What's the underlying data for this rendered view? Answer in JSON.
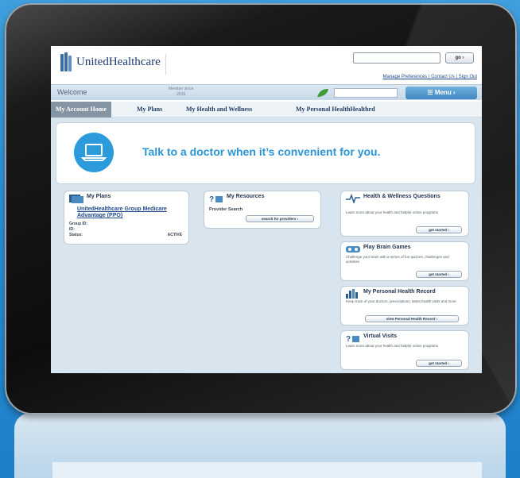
{
  "header": {
    "logo_text": "UnitedHealthcare",
    "go_label": "go ›",
    "util_links": "Manage Preferences | Contact Us | Sign Out"
  },
  "welcome_bar": {
    "welcome": "Welcome",
    "member_since_label": "Member since",
    "member_since_year": "2015",
    "menu_label": "Menu"
  },
  "nav": {
    "items": [
      "My Account Home",
      "My Plans",
      "My Health and Wellness",
      "My Personal HealthHealthrd"
    ]
  },
  "hero": {
    "text": "Talk to a doctor when it’s convenient for you."
  },
  "plans_card": {
    "title": "My Plans",
    "plan_name": "UnitedHealthcare Group Medicare Advantage (PPO)",
    "group_id_label": "Group ID:",
    "id_label": "ID:",
    "status_label": "Status:",
    "status_value": "ACTIVE"
  },
  "resources_card": {
    "title": "My Resources",
    "subtitle": "Provider Search",
    "button": "search for providers ›"
  },
  "side_cards": [
    {
      "title": "Health & Wellness Questions",
      "desc": "Learn more about your health and helpful online programs",
      "button": "get started ›",
      "icon": "heartbeat-icon"
    },
    {
      "title": "Play Brain Games",
      "desc": "Challenge your brain with a series of fun quizzes, challenges and activities",
      "button": "get started ›",
      "icon": "brain-icon"
    },
    {
      "title": "My Personal Health Record",
      "desc": "Keep track of your doctors, prescriptions, latest health visits and more",
      "button": "view Personal Health Record ›",
      "icon": "chart-icon"
    },
    {
      "title": "Virtual Visits",
      "desc": "Learn more about your health and helpful online programs",
      "button": "get started ›",
      "icon": "people-icon"
    }
  ]
}
